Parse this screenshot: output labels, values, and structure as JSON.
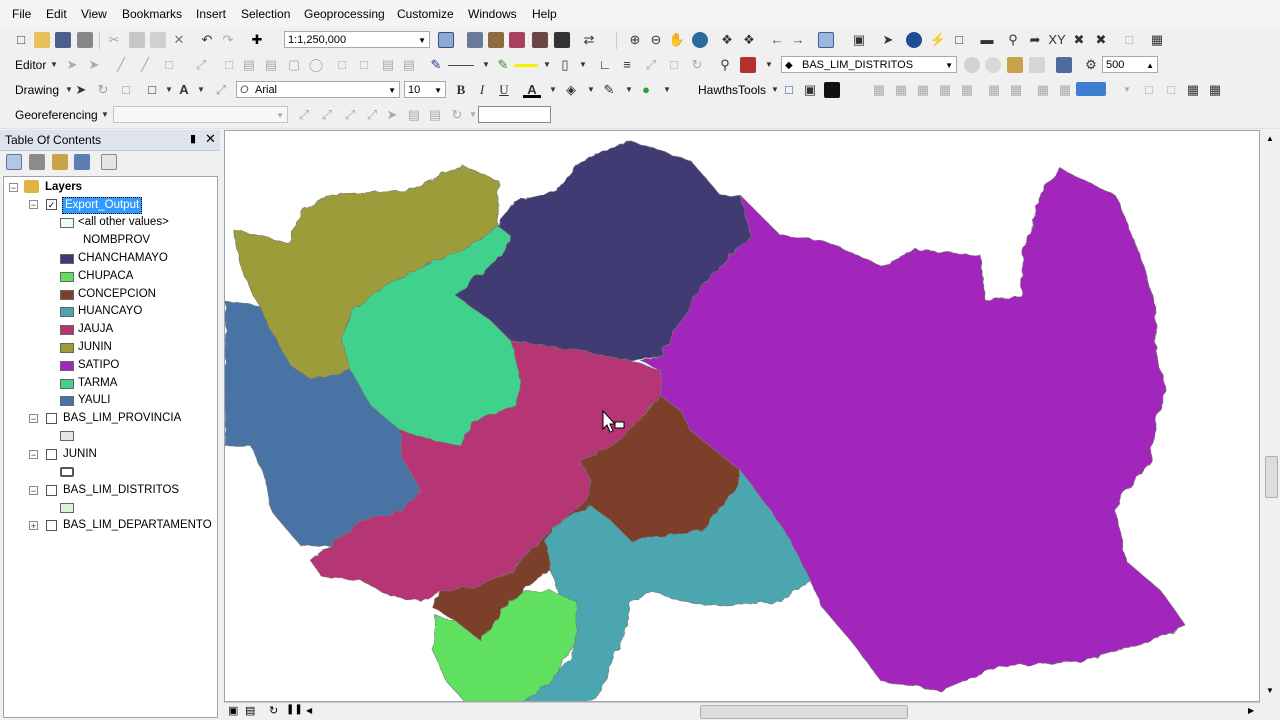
{
  "menu": [
    "File",
    "Edit",
    "View",
    "Bookmarks",
    "Insert",
    "Selection",
    "Geoprocessing",
    "Customize",
    "Windows",
    "Help"
  ],
  "toolbar": {
    "scale": "1:1,250,000",
    "editor": "Editor",
    "layer_target": "BAS_LIM_DISTRITOS",
    "snap_value": "500",
    "drawing": "Drawing",
    "font_name": "Arial",
    "font_size": "10",
    "bold": "B",
    "italic": "I",
    "underline": "U",
    "font_color_glyph": "A",
    "hawths": "HawthsTools",
    "georef": "Georeferencing"
  },
  "toc": {
    "title": "Table Of Contents",
    "pin_icon": "pin-icon",
    "close_icon": "close-icon",
    "layers_root": "Layers",
    "layer1": {
      "name": "Export_Output",
      "checked": true,
      "other_values": "<all other values>",
      "field": "NOMBPROV",
      "classes": [
        {
          "label": "CHANCHAMAYO",
          "color": "#3f3a72"
        },
        {
          "label": "CHUPACA",
          "color": "#5ee05e"
        },
        {
          "label": "CONCEPCION",
          "color": "#7c3f2c"
        },
        {
          "label": "HUANCAYO",
          "color": "#4ca6b0"
        },
        {
          "label": "JAUJA",
          "color": "#b53574"
        },
        {
          "label": "JUNIN",
          "color": "#9c9c3a"
        },
        {
          "label": "SATIPO",
          "color": "#a226bb"
        },
        {
          "label": "TARMA",
          "color": "#3fd18c"
        },
        {
          "label": "YAULI",
          "color": "#4a73a5"
        }
      ]
    },
    "other_layers": [
      {
        "name": "BAS_LIM_PROVINCIA",
        "swatch": "#e6e6e6"
      },
      {
        "name": "JUNIN",
        "swatch": "#ffffff"
      },
      {
        "name": "BAS_LIM_DISTRITOS",
        "swatch": "#d9f2d9"
      },
      {
        "name": "BAS_LIM_DEPARTAMENTO",
        "swatch": ""
      }
    ]
  },
  "map": {
    "regions": [
      {
        "name": "JUNIN",
        "color": "#9c9c3a"
      },
      {
        "name": "CHANCHAMAYO",
        "color": "#3f3a72"
      },
      {
        "name": "TARMA",
        "color": "#3fd18c"
      },
      {
        "name": "YAULI",
        "color": "#4a73a5"
      },
      {
        "name": "JAUJA",
        "color": "#b53574"
      },
      {
        "name": "SATIPO",
        "color": "#a226bb"
      },
      {
        "name": "CONCEPCION",
        "color": "#7c3f2c"
      },
      {
        "name": "HUANCAYO",
        "color": "#4ca6b0"
      },
      {
        "name": "CHUPACA",
        "color": "#5ee05e"
      }
    ]
  }
}
